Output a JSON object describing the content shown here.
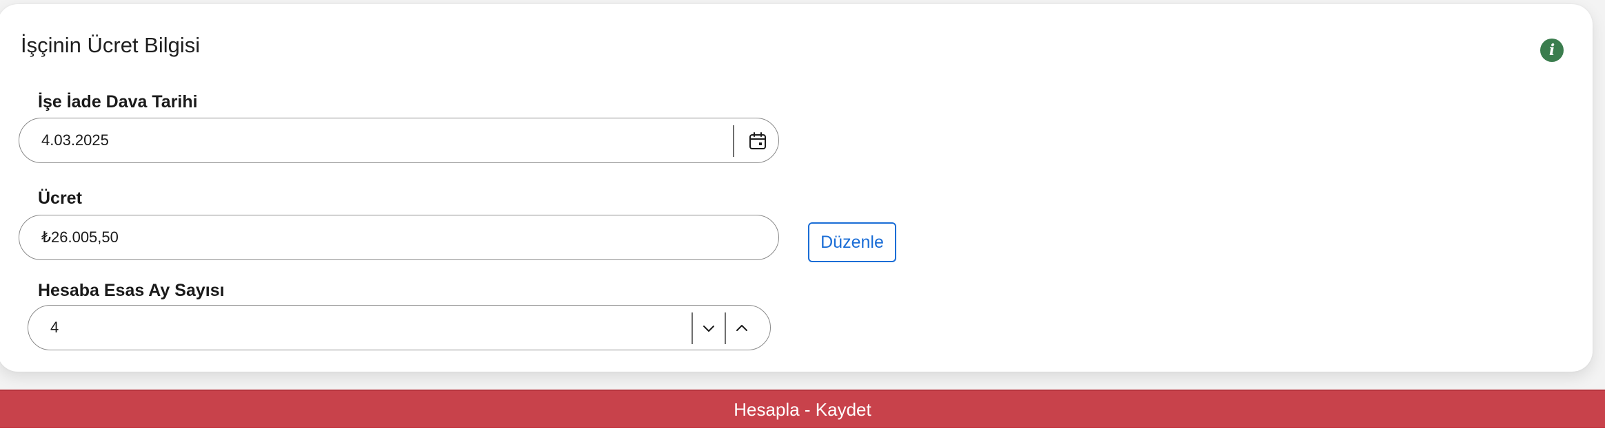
{
  "card": {
    "title": "İşçinin Ücret Bilgisi",
    "info_icon": "info-icon",
    "info_icon_glyph": "i",
    "info_icon_color": "#3b7d4e"
  },
  "fields": {
    "lawsuit_date": {
      "label": "İşe İade Dava Tarihi",
      "value": "4.03.2025",
      "icon": "calendar-icon"
    },
    "wage": {
      "label": "Ücret",
      "value": "₺26.005,50",
      "edit_label": "Düzenle"
    },
    "months": {
      "label": "Hesaba Esas Ay Sayısı",
      "value": "4",
      "decrement_icon": "chevron-down-icon",
      "increment_icon": "chevron-up-icon"
    }
  },
  "submit": {
    "label": "Hesapla - Kaydet",
    "color": "#c8424b"
  },
  "colors": {
    "accent_blue": "#1a6dd6"
  }
}
